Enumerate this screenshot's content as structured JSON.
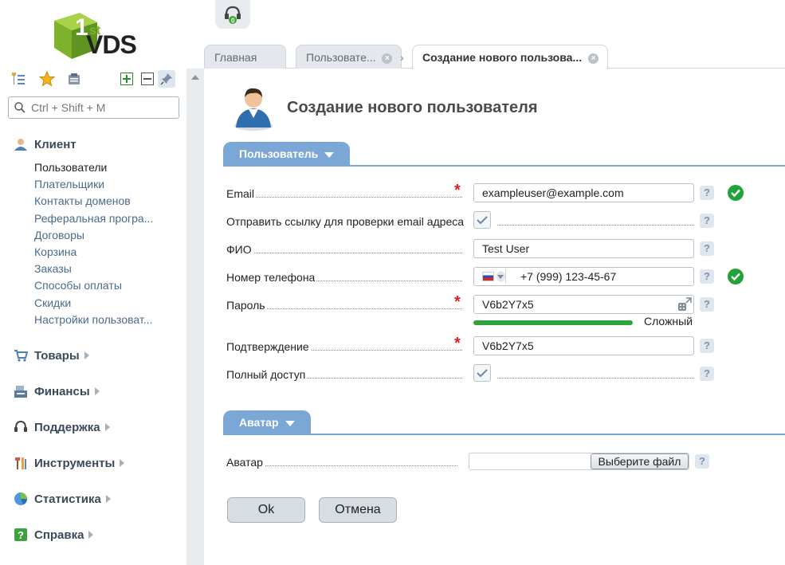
{
  "logo": {
    "brand": "VDS",
    "superscript": "st",
    "prefix": "1"
  },
  "search": {
    "placeholder": "Ctrl + Shift + M"
  },
  "nav": {
    "client": "Клиент",
    "client_items": [
      "Пользователи",
      "Плательщики",
      "Контакты доменов",
      "Реферальная програ...",
      "Договоры",
      "Корзина",
      "Заказы",
      "Способы оплаты",
      "Скидки",
      "Настройки пользоват..."
    ],
    "goods": "Товары",
    "finance": "Финансы",
    "support": "Поддержка",
    "tools": "Инструменты",
    "stats": "Статистика",
    "help": "Справка"
  },
  "tabs": [
    {
      "label": "Главная"
    },
    {
      "label": "Пользовате..."
    },
    {
      "label": "Создание нового пользова..."
    }
  ],
  "page": {
    "title": "Создание нового пользователя"
  },
  "section_user": {
    "label": "Пользователь"
  },
  "section_avatar": {
    "label": "Аватар"
  },
  "form": {
    "email": {
      "label": "Email",
      "value": "exampleuser@example.com",
      "valid": true
    },
    "send_link": {
      "label": "Отправить ссылку для проверки email адреса",
      "checked": true
    },
    "fio": {
      "label": "ФИО",
      "value": "Test User"
    },
    "phone": {
      "label": "Номер телефона",
      "value": "+7 (999) 123-45-67",
      "valid": true
    },
    "password": {
      "label": "Пароль",
      "value": "V6b2Y7x5",
      "strength": "Сложный",
      "strength_level": 1.0
    },
    "confirm": {
      "label": "Подтверждение",
      "value": "V6b2Y7x5"
    },
    "full_access": {
      "label": "Полный доступ",
      "checked": true
    },
    "avatar": {
      "label": "Аватар",
      "button": "Выберите файл"
    }
  },
  "help_mark": "?",
  "required_mark": "*",
  "buttons": {
    "ok": "Ok",
    "cancel": "Отмена"
  },
  "colors": {
    "accent": "#7ba7d6",
    "valid": "#22a33a",
    "required": "#e02020",
    "strength": "#2ea33e"
  }
}
